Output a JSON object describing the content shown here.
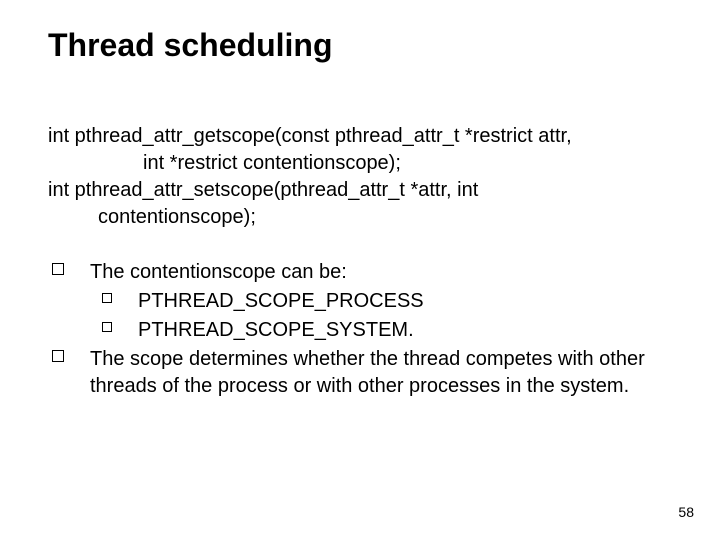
{
  "title": "Thread scheduling",
  "prototypes": {
    "l1": "int pthread_attr_getscope(const pthread_attr_t *restrict attr,",
    "l2": "int *restrict contentionscope);",
    "l3": "int pthread_attr_setscope(pthread_attr_t *attr, int",
    "l4": "contentionscope);"
  },
  "bullets": {
    "b1": "The contentionscope can be:",
    "s1": "PTHREAD_SCOPE_PROCESS",
    "s2": "PTHREAD_SCOPE_SYSTEM.",
    "b2": "The scope determines whether the thread competes with other threads of the process or with other processes in the system."
  },
  "page_number": "58"
}
